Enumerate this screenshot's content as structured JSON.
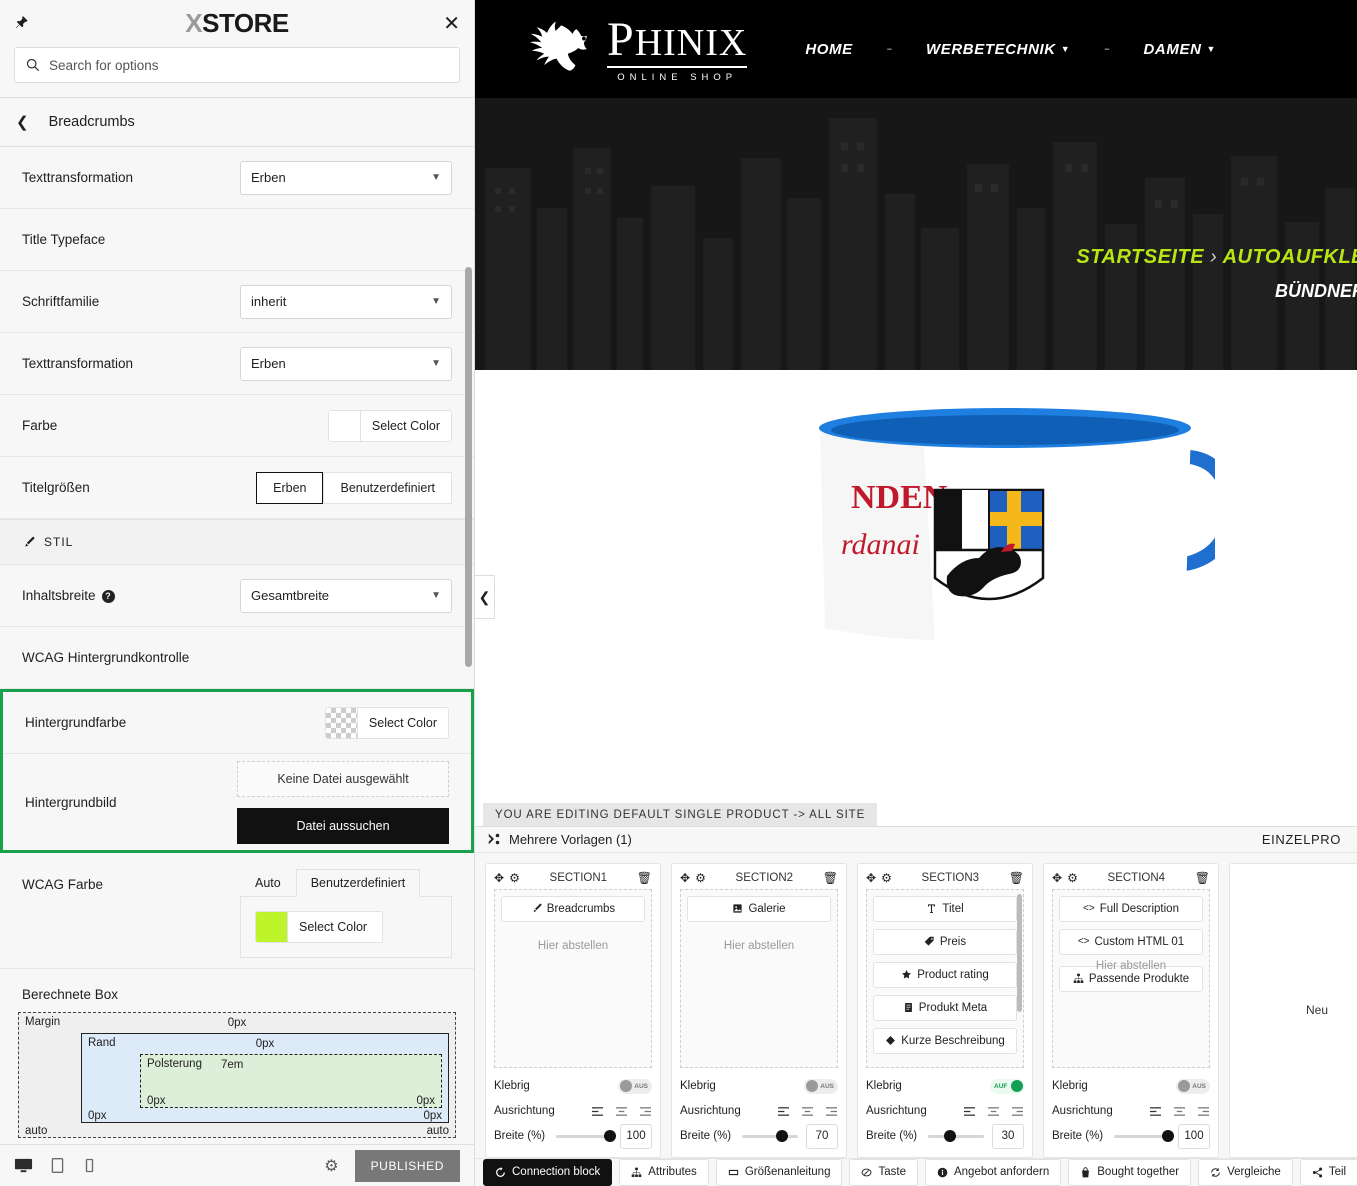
{
  "customizer": {
    "logo_x": "X",
    "logo_text": "STORE",
    "pin_icon": "pin-icon",
    "close_icon": "close-icon",
    "search": {
      "placeholder": "Search for options",
      "value": ""
    },
    "back_icon": "chevron-left-icon",
    "panel_title": "Breadcrumbs",
    "rows": [
      {
        "label": "Texttransformation",
        "control": "select",
        "value": "Erben"
      },
      {
        "label": "Title Typeface",
        "control": "heading"
      },
      {
        "label": "Schriftfamilie",
        "control": "select",
        "value": "inherit"
      },
      {
        "label": "Texttransformation",
        "control": "select",
        "value": "Erben"
      },
      {
        "label": "Farbe",
        "control": "color",
        "value": "Select Color"
      },
      {
        "label": "Titelgrößen",
        "control": "buttons",
        "options": [
          "Erben",
          "Benutzerdefiniert"
        ],
        "selected": "Erben"
      }
    ],
    "style_section": {
      "icon": "brush-icon",
      "label": "STIL"
    },
    "style_rows": [
      {
        "label": "Inhaltsbreite",
        "help": "?",
        "control": "select",
        "value": "Gesamtbreite"
      },
      {
        "label": "WCAG Hintergrundkontrolle",
        "control": "heading"
      }
    ],
    "highlight": {
      "bg_color_label": "Hintergrundfarbe",
      "bg_color_value": "Select Color",
      "bg_image_label": "Hintergrundbild",
      "no_file": "Keine Datei ausgewählt",
      "choose_file": "Datei aussuchen"
    },
    "wcag": {
      "label": "WCAG Farbe",
      "tabs": [
        "Auto",
        "Benutzerdefiniert"
      ],
      "selected_tab": "Benutzerdefiniert",
      "color_label": "Select Color",
      "color_hex": "#bdf52a"
    },
    "computed_box": {
      "title": "Berechnete Box",
      "margin_label": "Margin",
      "margin_value": "0px",
      "border_label": "Rand",
      "border_value": "0px",
      "padding_label": "Polsterung",
      "padding_value": "7em",
      "bottom_values": [
        "auto",
        "0px",
        "0px",
        "0px",
        "0px",
        "auto"
      ]
    },
    "footer": {
      "devices": [
        "desktop-icon",
        "tablet-icon",
        "mobile-icon"
      ],
      "gear": "gear-icon",
      "status": "PUBLISHED"
    }
  },
  "site": {
    "brand": {
      "name_cap": "P",
      "name_rest": "HINIX",
      "sub": "ONLINE SHOP",
      "logo": "pegasus-logo"
    },
    "nav": [
      {
        "label": "HOME",
        "caret": false
      },
      {
        "label": "WERBETECHNIK",
        "caret": true
      },
      {
        "label": "DAMEN",
        "caret": true
      }
    ],
    "breadcrumb": {
      "items": [
        "STARTSEITE",
        "AUTOAUFKLE"
      ],
      "separator": "›",
      "title": "BÜNDNER"
    },
    "collapse_icon": "chevron-left-icon",
    "edit_banner": "YOU ARE EDITING DEFAULT SINGLE PRODUCT -> ALL SITE"
  },
  "builder": {
    "templates_label": "Mehrere Vorlagen (1)",
    "templates_icon": "templates-icon",
    "right_label": "EINZELPRO",
    "add_section_label": "Neu",
    "sections": [
      {
        "name": "SECTION1",
        "widgets": [
          {
            "icon": "brush-icon",
            "label": "Breadcrumbs"
          }
        ],
        "drop_hint": "Hier abstellen",
        "sticky_label": "Klebrig",
        "sticky_state": "AUS",
        "sticky_on": false,
        "align_label": "Ausrichtung",
        "width_label": "Breite (%)",
        "width_value": "100"
      },
      {
        "name": "SECTION2",
        "widgets": [
          {
            "icon": "gallery-icon",
            "label": "Galerie"
          }
        ],
        "drop_hint": "Hier abstellen",
        "sticky_label": "Klebrig",
        "sticky_state": "AUS",
        "sticky_on": false,
        "align_label": "Ausrichtung",
        "width_label": "Breite (%)",
        "width_value": "70"
      },
      {
        "name": "SECTION3",
        "widgets": [
          {
            "icon": "title-icon",
            "label": "Titel"
          },
          {
            "icon": "price-tag-icon",
            "label": "Preis"
          },
          {
            "icon": "star-icon",
            "label": "Product rating"
          },
          {
            "icon": "meta-icon",
            "label": "Produkt Meta"
          },
          {
            "icon": "diamond-icon",
            "label": "Kurze Beschreibung"
          }
        ],
        "drop_hint": "",
        "sticky_label": "Klebrig",
        "sticky_state": "AUF",
        "sticky_on": true,
        "align_label": "Ausrichtung",
        "width_label": "Breite (%)",
        "width_value": "30"
      },
      {
        "name": "SECTION4",
        "widgets": [
          {
            "icon": "code-icon",
            "label": "Full Description"
          },
          {
            "icon": "code-icon",
            "label": "Custom HTML 01"
          },
          {
            "icon": "sitemap-icon",
            "label": "Passende Produkte"
          }
        ],
        "drop_hint": "Hier abstellen",
        "sticky_label": "Klebrig",
        "sticky_state": "AUS",
        "sticky_on": false,
        "align_label": "Ausrichtung",
        "width_label": "Breite (%)",
        "width_value": "100"
      }
    ],
    "chips": [
      {
        "icon": "connection-icon",
        "label": "Connection block",
        "active": true
      },
      {
        "icon": "attributes-icon",
        "label": "Attributes",
        "active": false
      },
      {
        "icon": "ruler-icon",
        "label": "Größenanleitung",
        "active": false
      },
      {
        "icon": "button-icon",
        "label": "Taste",
        "active": false
      },
      {
        "icon": "offer-icon",
        "label": "Angebot anfordern",
        "active": false
      },
      {
        "icon": "bag-icon",
        "label": "Bought together",
        "active": false
      },
      {
        "icon": "compare-icon",
        "label": "Vergleiche",
        "active": false
      },
      {
        "icon": "share-icon",
        "label": "Teil",
        "active": false
      }
    ]
  }
}
